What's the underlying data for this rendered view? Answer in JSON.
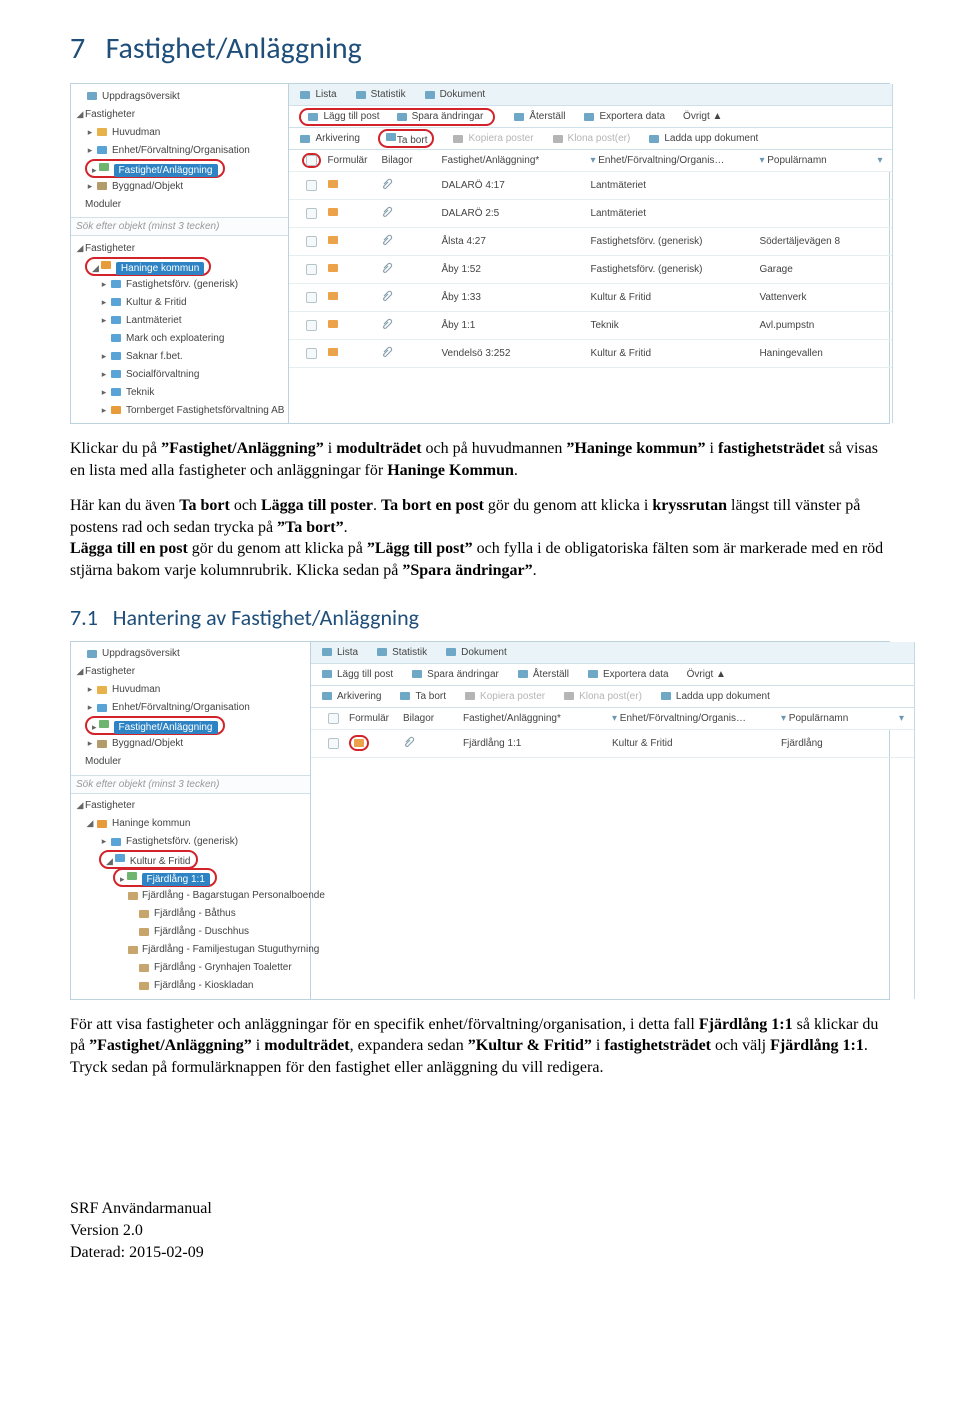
{
  "section": {
    "num": "7",
    "title": "Fastighet/Anläggning"
  },
  "para1_parts": [
    "Klickar du på ",
    "”Fastighet/Anläggning”",
    " i ",
    "modulträdet",
    " och på huvudmannen ",
    "”Haninge kommun”",
    " i ",
    "fastighetsträdet",
    " så visas en lista med alla fastigheter och anläggningar för ",
    "Haninge Kommun",
    "."
  ],
  "para2_parts": [
    "Här kan du även ",
    "Ta bort",
    " och ",
    "Lägga till poster",
    ". ",
    "Ta bort en post",
    " gör du genom att klicka i ",
    "kryssrutan",
    " längst till vänster på postens rad och sedan trycka på ",
    "”Ta bort”",
    ".\n",
    "Lägga till en post",
    " gör du genom att klicka på ",
    "”Lägg till post”",
    " och fylla i de obligatoriska fälten som är markerade med en röd stjärna bakom varje kolumnrubrik. Klicka sedan på ",
    "”Spara ändringar”",
    "."
  ],
  "subsection": {
    "num": "7.1",
    "title": "Hantering av Fastighet/Anläggning"
  },
  "para3_parts": [
    "För att visa fastigheter och anläggningar för en specifik enhet/förvaltning/organisation, i detta fall ",
    "Fjärdlång 1:1",
    " så klickar du på ",
    "”Fastighet/Anläggning”",
    " i ",
    "modulträdet",
    ", expandera sedan ",
    "”Kultur & Fritid”",
    " i ",
    "fastighetsträdet",
    " och välj ",
    "Fjärdlång 1:1",
    ". Tryck sedan på formulärknappen för den fastighet eller anläggning du vill redigera."
  ],
  "footer": {
    "l1": "SRF Användarmanual",
    "l2": "Version 2.0",
    "l3": "Daterad: 2015-02-09"
  },
  "shot1": {
    "sidebar_top": [
      {
        "lvl": 0,
        "arrow": "",
        "label": "Uppdragsöversikt",
        "ico": "grid"
      },
      {
        "lvl": 0,
        "arrow": "◢",
        "label": "Fastigheter"
      },
      {
        "lvl": 1,
        "arrow": "▸",
        "label": "Huvudman",
        "ico": "user"
      },
      {
        "lvl": 1,
        "arrow": "▸",
        "label": "Enhet/Förvaltning/Organisation",
        "ico": "org"
      },
      {
        "lvl": 1,
        "arrow": "▸",
        "label": "Fastighet/Anläggning",
        "ico": "house",
        "active": true,
        "red": true
      },
      {
        "lvl": 1,
        "arrow": "▸",
        "label": "Byggnad/Objekt",
        "ico": "bld"
      },
      {
        "lvl": 0,
        "arrow": "",
        "label": "Moduler"
      }
    ],
    "search_placeholder": "Sök efter objekt (minst 3 tecken)",
    "sidebar_bot": [
      {
        "lvl": 0,
        "arrow": "◢",
        "label": "Fastigheter"
      },
      {
        "lvl": 1,
        "arrow": "◢",
        "label": "Haninge kommun",
        "ico": "flag",
        "active": true,
        "red": true
      },
      {
        "lvl": 2,
        "arrow": "▸",
        "label": "Fastighetsförv. (generisk)",
        "ico": "org"
      },
      {
        "lvl": 2,
        "arrow": "▸",
        "label": "Kultur & Fritid",
        "ico": "org"
      },
      {
        "lvl": 2,
        "arrow": "▸",
        "label": "Lantmäteriet",
        "ico": "org"
      },
      {
        "lvl": 2,
        "arrow": "",
        "label": "Mark och exploatering",
        "ico": "org"
      },
      {
        "lvl": 2,
        "arrow": "▸",
        "label": "Saknar f.bet.",
        "ico": "org"
      },
      {
        "lvl": 2,
        "arrow": "▸",
        "label": "Socialförvaltning",
        "ico": "org"
      },
      {
        "lvl": 2,
        "arrow": "▸",
        "label": "Teknik",
        "ico": "org"
      },
      {
        "lvl": 2,
        "arrow": "▸",
        "label": "Tornberget Fastighetsförvaltning AB",
        "ico": "flag"
      }
    ],
    "tabs": [
      "Lista",
      "Statistik",
      "Dokument"
    ],
    "toolbar1": [
      "Lägg till post",
      "Spara ändringar",
      "Återställ",
      "Exportera data",
      "Övrigt ▲"
    ],
    "toolbar2": [
      {
        "label": "Arkivering"
      },
      {
        "label": "Ta bort",
        "red": true
      },
      {
        "label": "Kopiera poster",
        "dim": true
      },
      {
        "label": "Klona post(er)",
        "dim": true
      },
      {
        "label": "Ladda upp dokument"
      }
    ],
    "columns": [
      "Formulär",
      "Bilagor",
      "Fastighet/Anläggning*",
      "Enhet/Förvaltning/Organis…",
      "Populärnamn"
    ],
    "rows": [
      {
        "fa": "DALARÖ 4:17",
        "enh": "Lantmäteriet",
        "pop": ""
      },
      {
        "fa": "DALARÖ 2:5",
        "enh": "Lantmäteriet",
        "pop": ""
      },
      {
        "fa": "Ålsta 4:27",
        "enh": "Fastighetsförv. (generisk)",
        "pop": "Södertäljevägen 8"
      },
      {
        "fa": "Åby 1:52",
        "enh": "Fastighetsförv. (generisk)",
        "pop": "Garage"
      },
      {
        "fa": "Åby 1:33",
        "enh": "Kultur & Fritid",
        "pop": "Vattenverk"
      },
      {
        "fa": "Åby 1:1",
        "enh": "Teknik",
        "pop": "Avl.pumpstn"
      },
      {
        "fa": "Vendelsö 3:252",
        "enh": "Kultur & Fritid",
        "pop": "Haningevallen"
      }
    ]
  },
  "shot2": {
    "sidebar_top": [
      {
        "lvl": 0,
        "arrow": "",
        "label": "Uppdragsöversikt",
        "ico": "grid"
      },
      {
        "lvl": 0,
        "arrow": "◢",
        "label": "Fastigheter"
      },
      {
        "lvl": 1,
        "arrow": "▸",
        "label": "Huvudman",
        "ico": "user"
      },
      {
        "lvl": 1,
        "arrow": "▸",
        "label": "Enhet/Förvaltning/Organisation",
        "ico": "org"
      },
      {
        "lvl": 1,
        "arrow": "▸",
        "label": "Fastighet/Anläggning",
        "ico": "house",
        "active": true,
        "red": true
      },
      {
        "lvl": 1,
        "arrow": "▸",
        "label": "Byggnad/Objekt",
        "ico": "bld"
      },
      {
        "lvl": 0,
        "arrow": "",
        "label": "Moduler"
      }
    ],
    "search_placeholder": "Sök efter objekt (minst 3 tecken)",
    "sidebar_bot": [
      {
        "lvl": 0,
        "arrow": "◢",
        "label": "Fastigheter"
      },
      {
        "lvl": 1,
        "arrow": "◢",
        "label": "Haninge kommun",
        "ico": "flag"
      },
      {
        "lvl": 2,
        "arrow": "▸",
        "label": "Fastighetsförv. (generisk)",
        "ico": "org"
      },
      {
        "lvl": 2,
        "arrow": "◢",
        "label": "Kultur & Fritid",
        "ico": "org",
        "red": true
      },
      {
        "lvl": 3,
        "arrow": "▸",
        "label": "Fjärdlång 1:1",
        "ico": "house",
        "active": true,
        "red": true
      },
      {
        "lvl": 4,
        "arrow": "",
        "label": "Fjärdlång - Bagarstugan Personalboende",
        "ico": "cabin"
      },
      {
        "lvl": 4,
        "arrow": "",
        "label": "Fjärdlång - Båthus",
        "ico": "cabin"
      },
      {
        "lvl": 4,
        "arrow": "",
        "label": "Fjärdlång - Duschhus",
        "ico": "cabin"
      },
      {
        "lvl": 4,
        "arrow": "",
        "label": "Fjärdlång - Familjestugan Stuguthyrning",
        "ico": "cabin"
      },
      {
        "lvl": 4,
        "arrow": "",
        "label": "Fjärdlång - Grynhajen Toaletter",
        "ico": "cabin"
      },
      {
        "lvl": 4,
        "arrow": "",
        "label": "Fjärdlång - Kioskladan",
        "ico": "cabin"
      }
    ],
    "tabs": [
      "Lista",
      "Statistik",
      "Dokument"
    ],
    "toolbar1": [
      "Lägg till post",
      "Spara ändringar",
      "Återställ",
      "Exportera data",
      "Övrigt ▲"
    ],
    "toolbar2": [
      {
        "label": "Arkivering"
      },
      {
        "label": "Ta bort"
      },
      {
        "label": "Kopiera poster",
        "dim": true
      },
      {
        "label": "Klona post(er)",
        "dim": true
      },
      {
        "label": "Ladda upp dokument"
      }
    ],
    "columns": [
      "Formulär",
      "Bilagor",
      "Fastighet/Anläggning*",
      "Enhet/Förvaltning/Organis…",
      "Populärnamn"
    ],
    "rows": [
      {
        "fa": "Fjärdlång 1:1",
        "enh": "Kultur & Fritid",
        "pop": "Fjärdlång",
        "formred": true
      }
    ]
  }
}
